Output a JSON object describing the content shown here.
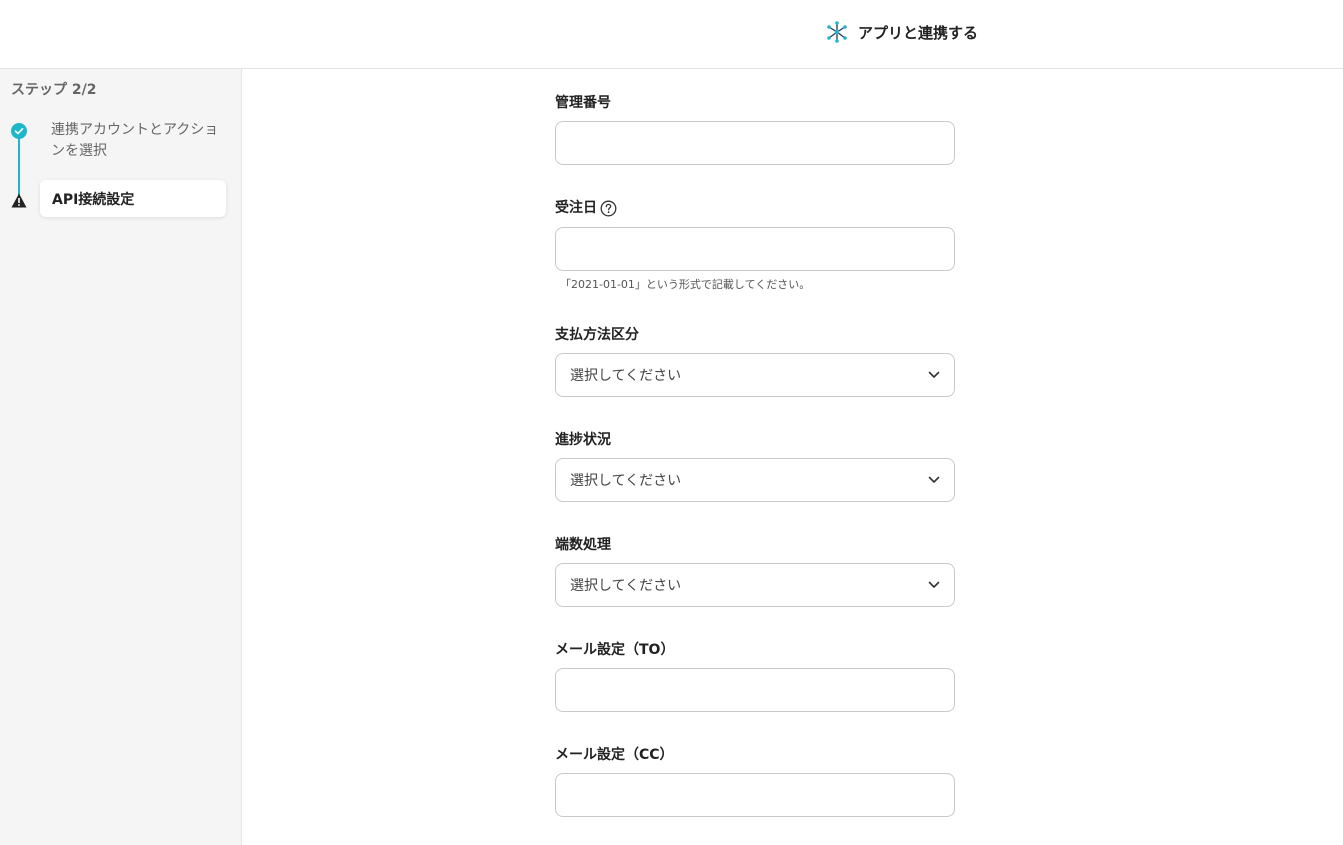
{
  "header": {
    "title": "アプリと連携する",
    "icon": "network-icon"
  },
  "sidebar": {
    "step_count": "ステップ 2/2",
    "steps": [
      {
        "label": "連携アカウントとアクションを選択",
        "status": "complete"
      },
      {
        "label": "API接続設定",
        "status": "warning"
      }
    ]
  },
  "form": {
    "fields": [
      {
        "label": "管理番号",
        "type": "text",
        "value": ""
      },
      {
        "label": "受注日",
        "type": "text",
        "value": "",
        "hint": "「2021-01-01」という形式で記載してください。",
        "help_icon": "question-circle-icon"
      },
      {
        "label": "支払方法区分",
        "type": "select",
        "value": "選択してください"
      },
      {
        "label": "進捗状況",
        "type": "select",
        "value": "選択してください"
      },
      {
        "label": "端数処理",
        "type": "select",
        "value": "選択してください"
      },
      {
        "label": "メール設定（TO）",
        "type": "text",
        "value": ""
      },
      {
        "label": "メール設定（CC）",
        "type": "text",
        "value": ""
      }
    ]
  },
  "colors": {
    "accent": "#1fb6c9",
    "warning": "#222222",
    "border": "#c9c9c9"
  }
}
